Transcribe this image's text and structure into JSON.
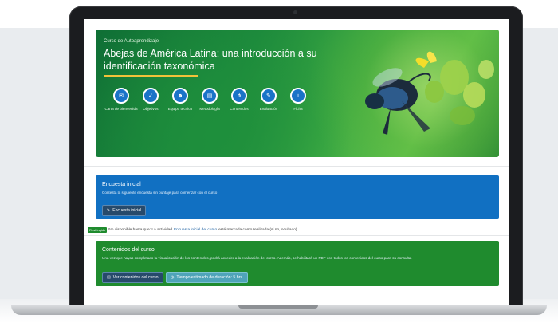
{
  "hero": {
    "kicker": "Curso de Autoaprendizaje",
    "title": "Abejas de América Latina: una introducción a su identificación taxonómica",
    "accent_color": "#f2c23a",
    "nav": [
      {
        "label": "Carta de bienvenida",
        "icon": "mail-icon"
      },
      {
        "label": "Objetivos",
        "icon": "check-icon"
      },
      {
        "label": "Equipo técnico",
        "icon": "team-icon"
      },
      {
        "label": "Metodología",
        "icon": "document-icon"
      },
      {
        "label": "Contenidos",
        "icon": "sitemap-icon"
      },
      {
        "label": "Evaluación",
        "icon": "edit-icon"
      },
      {
        "label": "Ficha",
        "icon": "info-icon"
      }
    ]
  },
  "survey": {
    "title": "Encuesta inicial",
    "description": "Contesta la siguiente encuesta sin puntaje para comenzar con el curso",
    "button_label": "Encuesta inicial",
    "color": "#1170c2"
  },
  "restriction": {
    "badge": "Restringido",
    "prefix": "No disponible hasta que: La actividad",
    "link": "Encuesta inicial del curso",
    "suffix": "esté marcada como realizada (si no, ocultado)"
  },
  "contents": {
    "title": "Contenidos del curso",
    "description": "Una vez que hayas completado la visualización de los contenidos, podrá acceder a la evaluación del curso. Además, se habilitará un PDF con todos los contenidos del curso para su consulta.",
    "button_view": "Ver contenidos del curso",
    "button_time": "Tiempo estimado de duración: 5 hrs.",
    "color": "#1f8b2e"
  }
}
